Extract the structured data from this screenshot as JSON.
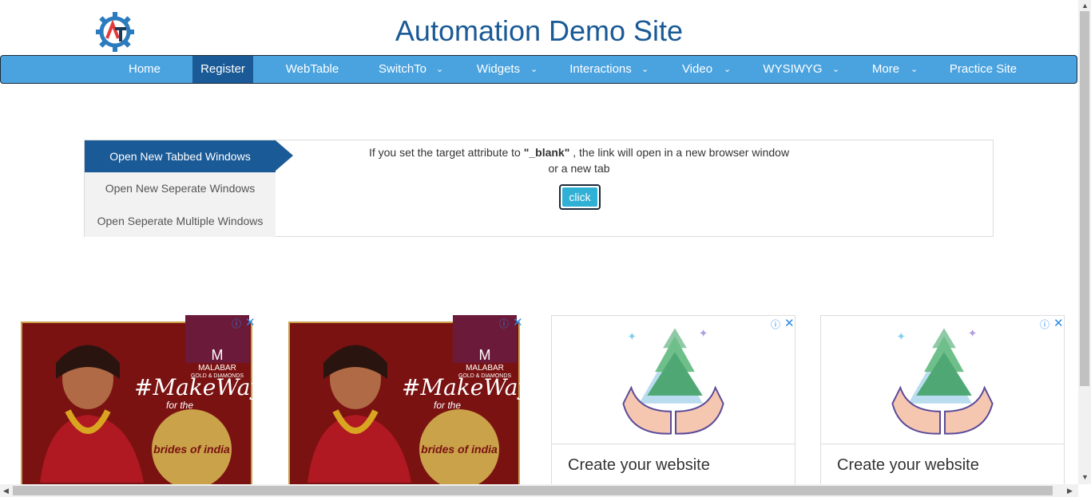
{
  "header": {
    "site_title": "Automation Demo Site",
    "logo_icon": "gear-logo-icon"
  },
  "nav": {
    "items": [
      {
        "label": "Home",
        "dropdown": false,
        "active": false
      },
      {
        "label": "Register",
        "dropdown": false,
        "active": true
      },
      {
        "label": "WebTable",
        "dropdown": false,
        "active": false
      },
      {
        "label": "SwitchTo",
        "dropdown": true,
        "active": false
      },
      {
        "label": "Widgets",
        "dropdown": true,
        "active": false
      },
      {
        "label": "Interactions",
        "dropdown": true,
        "active": false
      },
      {
        "label": "Video",
        "dropdown": true,
        "active": false
      },
      {
        "label": "WYSIWYG",
        "dropdown": true,
        "active": false
      },
      {
        "label": "More",
        "dropdown": true,
        "active": false
      },
      {
        "label": "Practice Site",
        "dropdown": false,
        "active": false
      }
    ],
    "caret_glyph": "⌄",
    "colors": {
      "bar": "#4aa3df",
      "active": "#1a5a96"
    }
  },
  "windows_panel": {
    "tabs": [
      {
        "label": "Open New Tabbed Windows",
        "active": true
      },
      {
        "label": "Open New Seperate Windows",
        "active": false
      },
      {
        "label": "Open Seperate Multiple Windows",
        "active": false
      }
    ],
    "description_prefix": "If you set the target attribute to",
    "description_code": "\"_blank\"",
    "description_suffix": ", the link will open in a new browser window",
    "description_line2": "or a new tab",
    "button_label": "click"
  },
  "ads": [
    {
      "type": "photo",
      "brand_line1": "MALABAR",
      "brand_line2": "GOLD & DIAMONDS",
      "brand_mark": "M",
      "tagline": "#MakeWay",
      "sub": "for the",
      "medal": "brides of india"
    },
    {
      "type": "photo",
      "brand_line1": "MALABAR",
      "brand_line2": "GOLD & DIAMONDS",
      "brand_mark": "M",
      "tagline": "#MakeWay",
      "sub": "for the",
      "medal": "brides of india"
    },
    {
      "type": "card",
      "cta": "Create your website"
    },
    {
      "type": "card",
      "cta": "Create your website"
    }
  ],
  "ad_icons": {
    "info": "ⓘ",
    "close": "✕"
  }
}
